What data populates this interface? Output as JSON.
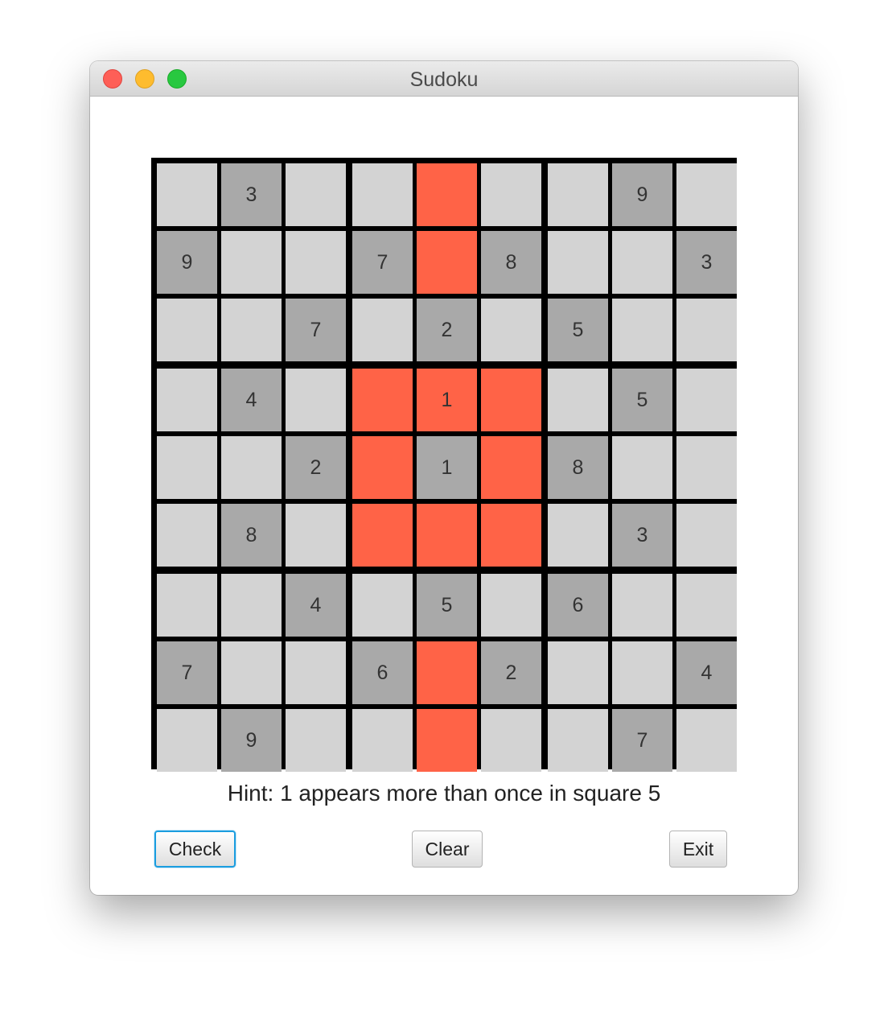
{
  "window": {
    "title": "Sudoku"
  },
  "grid": [
    [
      {
        "value": "",
        "state": "empty"
      },
      {
        "value": "3",
        "state": "given"
      },
      {
        "value": "",
        "state": "empty"
      },
      {
        "value": "",
        "state": "empty"
      },
      {
        "value": "",
        "state": "conflict"
      },
      {
        "value": "",
        "state": "empty"
      },
      {
        "value": "",
        "state": "empty"
      },
      {
        "value": "9",
        "state": "given"
      },
      {
        "value": "",
        "state": "empty"
      }
    ],
    [
      {
        "value": "9",
        "state": "given"
      },
      {
        "value": "",
        "state": "empty"
      },
      {
        "value": "",
        "state": "empty"
      },
      {
        "value": "7",
        "state": "given"
      },
      {
        "value": "",
        "state": "conflict"
      },
      {
        "value": "8",
        "state": "given"
      },
      {
        "value": "",
        "state": "empty"
      },
      {
        "value": "",
        "state": "empty"
      },
      {
        "value": "3",
        "state": "given"
      }
    ],
    [
      {
        "value": "",
        "state": "empty"
      },
      {
        "value": "",
        "state": "empty"
      },
      {
        "value": "7",
        "state": "given"
      },
      {
        "value": "",
        "state": "empty"
      },
      {
        "value": "2",
        "state": "given"
      },
      {
        "value": "",
        "state": "empty"
      },
      {
        "value": "5",
        "state": "given"
      },
      {
        "value": "",
        "state": "empty"
      },
      {
        "value": "",
        "state": "empty"
      }
    ],
    [
      {
        "value": "",
        "state": "empty"
      },
      {
        "value": "4",
        "state": "given"
      },
      {
        "value": "",
        "state": "empty"
      },
      {
        "value": "",
        "state": "conflict"
      },
      {
        "value": "1",
        "state": "conflict"
      },
      {
        "value": "",
        "state": "conflict"
      },
      {
        "value": "",
        "state": "empty"
      },
      {
        "value": "5",
        "state": "given"
      },
      {
        "value": "",
        "state": "empty"
      }
    ],
    [
      {
        "value": "",
        "state": "empty"
      },
      {
        "value": "",
        "state": "empty"
      },
      {
        "value": "2",
        "state": "given"
      },
      {
        "value": "",
        "state": "conflict"
      },
      {
        "value": "1",
        "state": "given"
      },
      {
        "value": "",
        "state": "conflict"
      },
      {
        "value": "8",
        "state": "given"
      },
      {
        "value": "",
        "state": "empty"
      },
      {
        "value": "",
        "state": "empty"
      }
    ],
    [
      {
        "value": "",
        "state": "empty"
      },
      {
        "value": "8",
        "state": "given"
      },
      {
        "value": "",
        "state": "empty"
      },
      {
        "value": "",
        "state": "conflict"
      },
      {
        "value": "",
        "state": "conflict"
      },
      {
        "value": "",
        "state": "conflict"
      },
      {
        "value": "",
        "state": "empty"
      },
      {
        "value": "3",
        "state": "given"
      },
      {
        "value": "",
        "state": "empty"
      }
    ],
    [
      {
        "value": "",
        "state": "empty"
      },
      {
        "value": "",
        "state": "empty"
      },
      {
        "value": "4",
        "state": "given"
      },
      {
        "value": "",
        "state": "empty"
      },
      {
        "value": "5",
        "state": "given"
      },
      {
        "value": "",
        "state": "empty"
      },
      {
        "value": "6",
        "state": "given"
      },
      {
        "value": "",
        "state": "empty"
      },
      {
        "value": "",
        "state": "empty"
      }
    ],
    [
      {
        "value": "7",
        "state": "given"
      },
      {
        "value": "",
        "state": "empty"
      },
      {
        "value": "",
        "state": "empty"
      },
      {
        "value": "6",
        "state": "given"
      },
      {
        "value": "",
        "state": "conflict"
      },
      {
        "value": "2",
        "state": "given"
      },
      {
        "value": "",
        "state": "empty"
      },
      {
        "value": "",
        "state": "empty"
      },
      {
        "value": "4",
        "state": "given"
      }
    ],
    [
      {
        "value": "",
        "state": "empty"
      },
      {
        "value": "9",
        "state": "given"
      },
      {
        "value": "",
        "state": "empty"
      },
      {
        "value": "",
        "state": "empty"
      },
      {
        "value": "",
        "state": "conflict"
      },
      {
        "value": "",
        "state": "empty"
      },
      {
        "value": "",
        "state": "empty"
      },
      {
        "value": "7",
        "state": "given"
      },
      {
        "value": "",
        "state": "empty"
      }
    ]
  ],
  "colors": {
    "empty": "#d3d3d3",
    "given": "#a9a9a9",
    "conflict": "#ff6347",
    "grid_line": "#000000",
    "focus_ring": "#1b9ddf"
  },
  "hint": "Hint: 1 appears more than once in square 5",
  "buttons": {
    "check": "Check",
    "clear": "Clear",
    "exit": "Exit"
  }
}
